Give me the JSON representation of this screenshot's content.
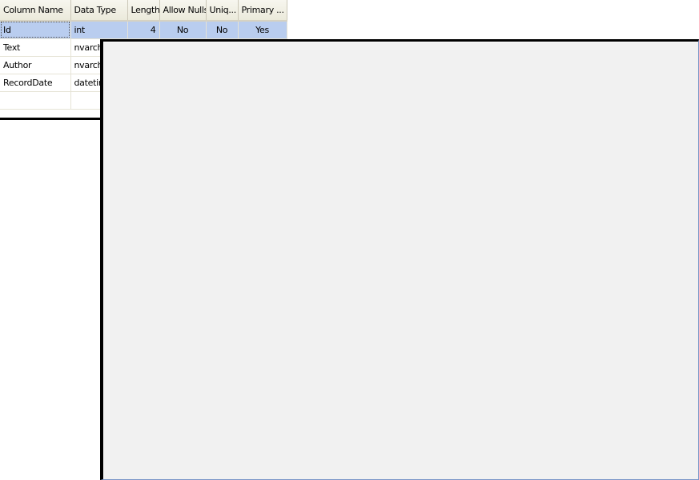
{
  "grid": {
    "columns": [
      "Column Name",
      "Data Type",
      "Length",
      "Allow Nulls",
      "Uniq...",
      "Primary ..."
    ],
    "rows": [
      {
        "name": "Id",
        "type": "int",
        "length": "4",
        "nulls": "No",
        "unique": "No",
        "primary": "Yes",
        "selected": true
      },
      {
        "name": "Text",
        "type": "nvarcha",
        "length": "",
        "nulls": "",
        "unique": "",
        "primary": ""
      },
      {
        "name": "Author",
        "type": "nvarcha",
        "length": "",
        "nulls": "",
        "unique": "",
        "primary": ""
      },
      {
        "name": "RecordDate",
        "type": "datetim",
        "length": "",
        "nulls": "",
        "unique": "",
        "primary": ""
      },
      {
        "name": "",
        "type": "",
        "length": "",
        "nulls": "",
        "unique": "",
        "primary": ""
      }
    ]
  },
  "colors": {
    "header_bg": "#ebeadb",
    "selected_row": "#b9cdef",
    "panel_bg": "#f1f1f1",
    "panel_edge": "#7a96c8"
  }
}
